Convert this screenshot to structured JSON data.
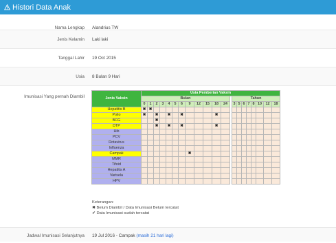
{
  "panel": {
    "title": "Histori Data Anak",
    "title_icon": "alert-triangle-icon"
  },
  "fields": {
    "nama": {
      "label": "Nama Lengkap",
      "value": "Alandrius TW"
    },
    "jenis_kelamin": {
      "label": "Jenis Kelamin",
      "value": "Laki laki"
    },
    "tanggal_lahir": {
      "label": "Tanggal Lahir",
      "value": "19 Oct 2015"
    },
    "usia": {
      "label": "Usia",
      "value": "8 Bulan 9 Hari"
    },
    "imunisasi": {
      "label": "Imunisasi Yang pernah Diambil"
    },
    "jadwal": {
      "label": "Jadwal Imunisasi Selanjutnya",
      "value": "19 Jul 2016 - Campak",
      "note": "(masih 21 hari lagi)"
    }
  },
  "table": {
    "vaccine_header": "Jenis Vaksin",
    "group_header": "Usia Pemberian Vaksin",
    "bulan_header": "Bulan",
    "tahun_header": "Tahun",
    "bulan_cols": [
      "0",
      "1",
      "2",
      "3",
      "4",
      "5",
      "6",
      "9",
      "12",
      "15",
      "18",
      "24"
    ],
    "tahun_cols": [
      "3",
      "5",
      "6",
      "7",
      "8",
      "10",
      "12",
      "18"
    ],
    "rows": [
      {
        "name": "Hepatitis B",
        "color": "#ffff00",
        "marks": [
          0,
          1
        ]
      },
      {
        "name": "Polio",
        "color": "#ffff00",
        "marks": [
          0,
          2,
          4,
          6,
          10
        ]
      },
      {
        "name": "BCG",
        "color": "#ffff00",
        "marks": [
          2
        ]
      },
      {
        "name": "DTP",
        "color": "#ffff00",
        "marks": [
          2,
          4,
          6,
          10
        ]
      },
      {
        "name": "Hib",
        "color": "#b0b0ef",
        "marks": []
      },
      {
        "name": "PCV",
        "color": "#b0b0ef",
        "marks": []
      },
      {
        "name": "Rotavirus",
        "color": "#b0b0ef",
        "marks": []
      },
      {
        "name": "Influenza",
        "color": "#b0b0ef",
        "marks": []
      },
      {
        "name": "Campak",
        "color": "#ffff00",
        "marks": [
          7
        ]
      },
      {
        "name": "MMR",
        "color": "#b0b0ef",
        "marks": []
      },
      {
        "name": "Tifoid",
        "color": "#b0b0ef",
        "marks": []
      },
      {
        "name": "Hepatitis A",
        "color": "#b0b0ef",
        "marks": []
      },
      {
        "name": "Varisela",
        "color": "#b0b0ef",
        "marks": []
      },
      {
        "name": "HPV",
        "color": "#b0b0ef",
        "marks": []
      }
    ]
  },
  "legend": {
    "title": "Keterangan:",
    "item1": "Belum Diambil / Data Imunisasi Belum tercatat",
    "item1_icon": "cross-icon",
    "item2": "Data Imunisasi sudah tercatat",
    "item2_icon": "check-icon"
  },
  "colors": {
    "header_bar": "#2e9bd6",
    "green": "#3fb53f",
    "light_green": "#cfeeb9",
    "cell": "#fae9da",
    "yellow": "#ffff00",
    "lavender": "#b0b0ef",
    "link": "#2a6cd8"
  }
}
